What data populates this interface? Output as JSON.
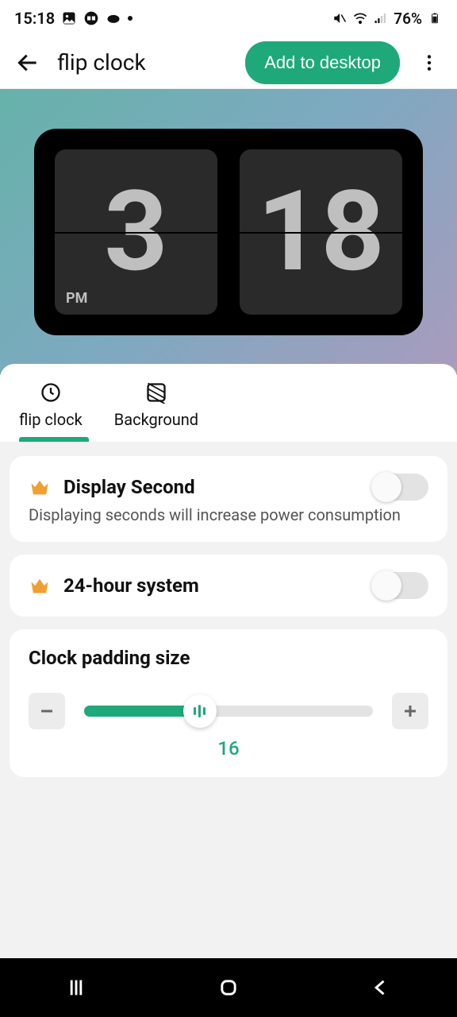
{
  "status": {
    "time": "15:18",
    "battery_text": "76%"
  },
  "header": {
    "title": "flip clock",
    "add_label": "Add to desktop"
  },
  "clock": {
    "hour": "3",
    "minute": "18",
    "ampm": "PM"
  },
  "tabs": {
    "flip_label": "flip clock",
    "bg_label": "Background"
  },
  "settings": {
    "display_second": {
      "title": "Display Second",
      "subtitle": "Displaying seconds will increase power consumption",
      "value": false
    },
    "hour24": {
      "title": "24-hour system",
      "value": false
    },
    "padding": {
      "title": "Clock padding size",
      "value": "16",
      "percent": 40
    }
  }
}
